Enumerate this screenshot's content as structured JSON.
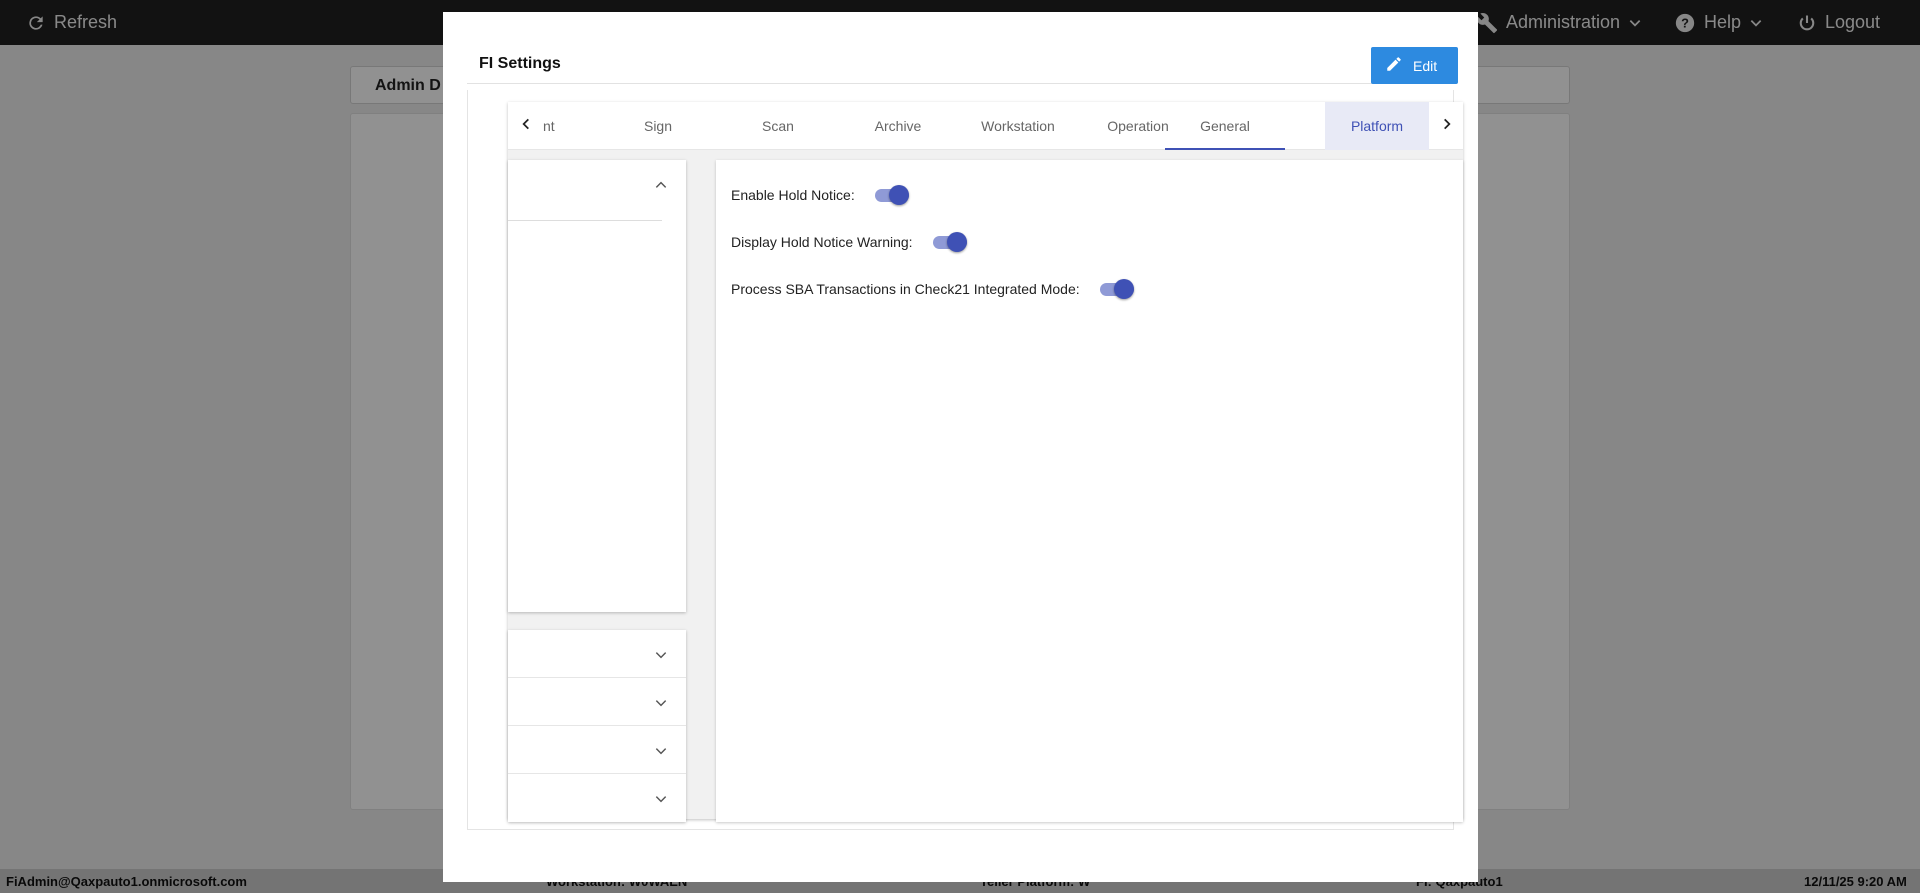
{
  "topbar": {
    "refresh_label": "Refresh",
    "administration_label": "Administration",
    "help_label": "Help",
    "logout_label": "Logout"
  },
  "background": {
    "page_title": "Admin D"
  },
  "statusbar": {
    "user": "FiAdmin@Qaxpauto1.onmicrosoft.com",
    "workstation": "Workstation: W0WAEN",
    "teller": "Teller Platform: W",
    "fi": "FI: Qaxpauto1",
    "datetime": "12/11/25 9:20 AM"
  },
  "dialog": {
    "title": "FI Settings",
    "edit_label": "Edit",
    "tabs": [
      {
        "label": "nt"
      },
      {
        "label": "Sign"
      },
      {
        "label": "Scan"
      },
      {
        "label": "Archive"
      },
      {
        "label": "Workstation"
      },
      {
        "label": "Operation"
      },
      {
        "label": "General"
      },
      {
        "label": "Platform"
      }
    ],
    "selected_tab": "Platform",
    "settings": [
      {
        "label": "Enable Hold Notice:",
        "enabled": true
      },
      {
        "label": "Display Hold Notice Warning:",
        "enabled": true
      },
      {
        "label": "Process SBA Transactions in Check21 Integrated Mode:",
        "enabled": true
      }
    ]
  },
  "colors": {
    "accent": "#3f51b5",
    "edit_button": "#2d8ae0",
    "topbar": "#1f1f1f"
  },
  "icons": {
    "refresh": "refresh-icon",
    "administration": "wrench-icon",
    "help": "question-circle-icon",
    "logout": "power-icon",
    "edit": "pencil-icon"
  }
}
